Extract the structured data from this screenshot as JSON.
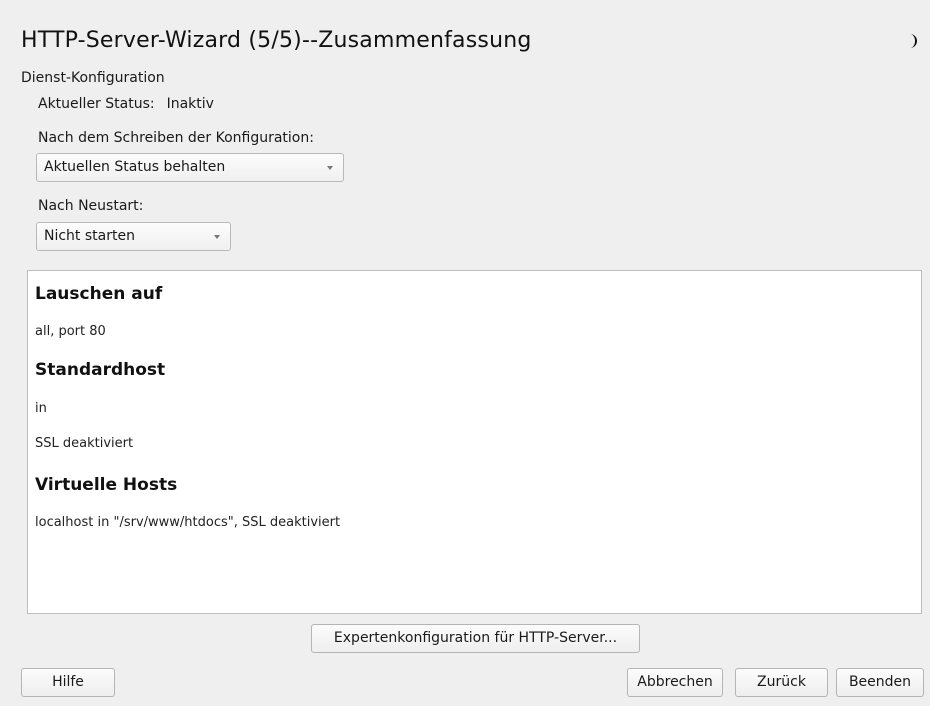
{
  "window": {
    "title": "HTTP-Server-Wizard (5/5)--Zusammenfassung"
  },
  "service": {
    "section_label": "Dienst-Konfiguration",
    "status_label": "Aktueller Status:",
    "status_value": "Inaktiv",
    "after_write_label": "Nach dem Schreiben der Konfiguration:",
    "after_write_value": "Aktuellen Status behalten",
    "after_reboot_label": "Nach Neustart:",
    "after_reboot_value": "Nicht starten"
  },
  "summary": {
    "listen_heading": "Lauschen auf",
    "listen_value": "all, port 80",
    "default_host_heading": "Standardhost",
    "default_host_value": "in",
    "default_host_ssl": "SSL deaktiviert",
    "virtual_hosts_heading": "Virtuelle Hosts",
    "virtual_hosts_value": "localhost in \"/srv/www/htdocs\", SSL deaktiviert"
  },
  "buttons": {
    "expert": "Expertenkonfiguration für HTTP-Server...",
    "help": "Hilfe",
    "cancel": "Abbrechen",
    "back": "Zurück",
    "finish": "Beenden"
  },
  "icons": {
    "status_icon": "moon-icon"
  }
}
